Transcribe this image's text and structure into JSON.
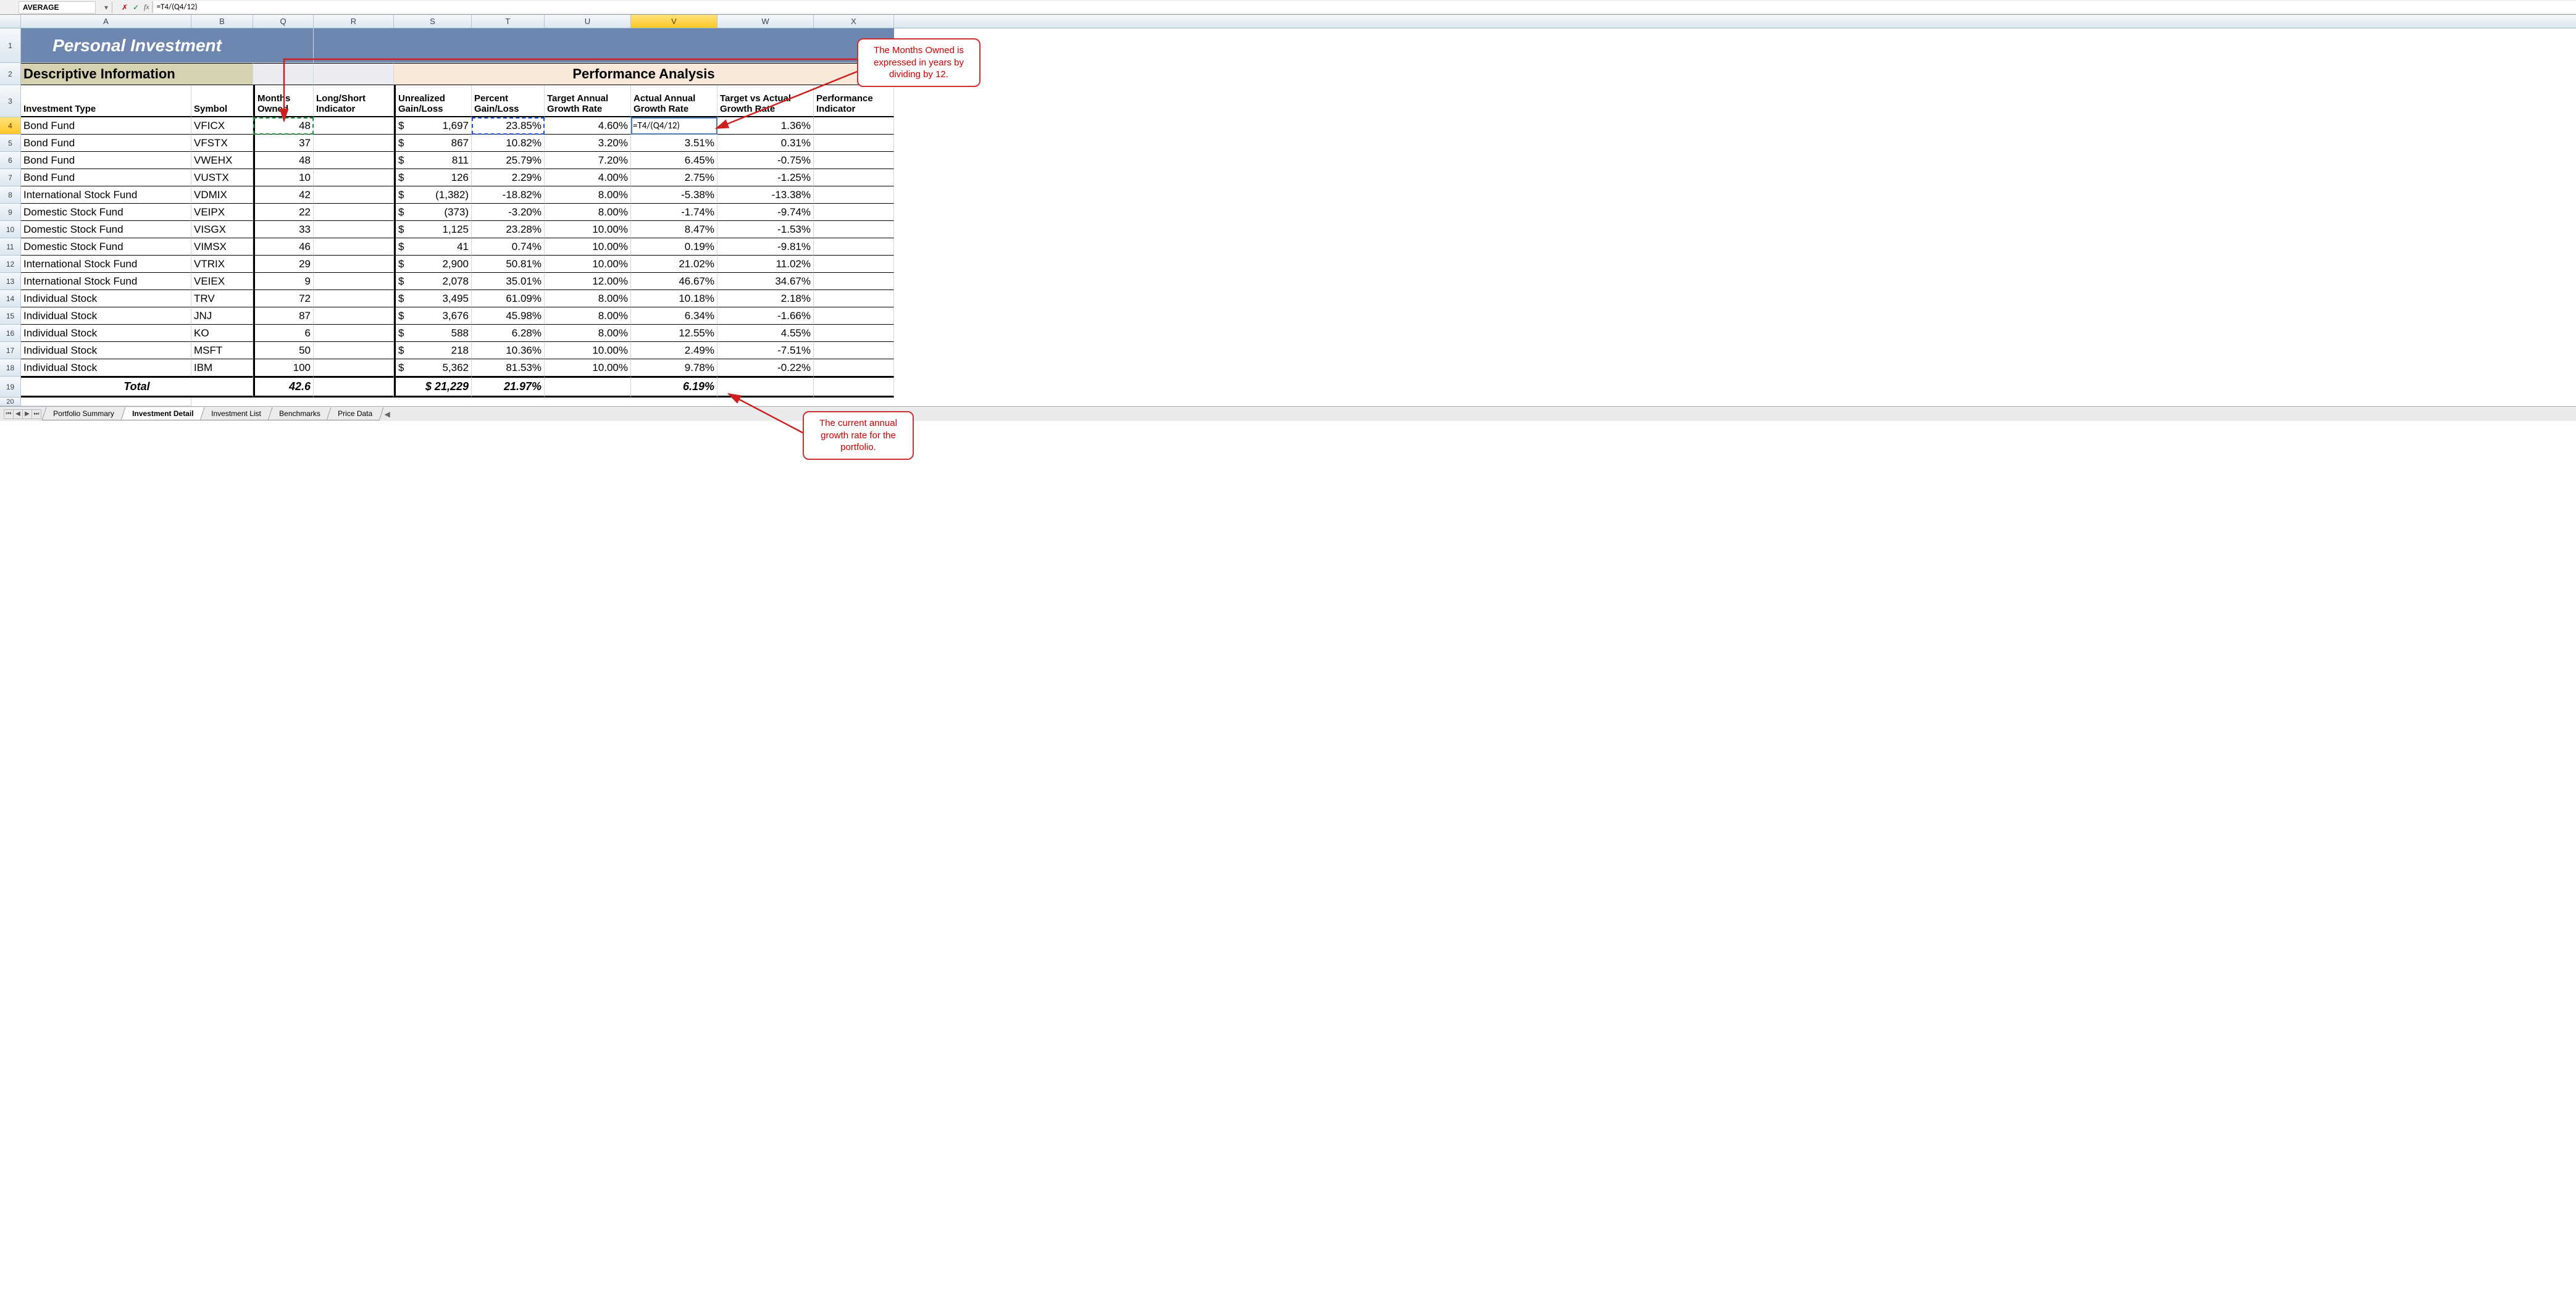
{
  "formula_bar": {
    "name_box": "AVERAGE",
    "dropdown_glyph": "▾",
    "cancel_glyph": "✗",
    "enter_glyph": "✓",
    "fx_label": "fx",
    "formula": "=T4/(Q4/12)"
  },
  "columns": [
    "A",
    "B",
    "Q",
    "R",
    "S",
    "T",
    "U",
    "V",
    "W",
    "X"
  ],
  "active_column": "V",
  "row_numbers": [
    1,
    2,
    3,
    4,
    5,
    6,
    7,
    8,
    9,
    10,
    11,
    12,
    13,
    14,
    15,
    16,
    17,
    18,
    19,
    20
  ],
  "active_row": 4,
  "titles": {
    "main": "Personal Investment",
    "descriptive": "Descriptive Information",
    "performance": "Performance Analysis"
  },
  "headers": {
    "investment_type": "Investment Type",
    "symbol": "Symbol",
    "months_owned": "Months Owned",
    "long_short": "Long/Short Indicator",
    "unrealized": "Unrealized Gain/Loss",
    "percent_gl": "Percent Gain/Loss",
    "target_annual": "Target Annual Growth Rate",
    "actual_annual": "Actual Annual Growth Rate",
    "target_vs_actual": "Target vs Actual Growth Rate",
    "perf_indicator": "Performance Indicator"
  },
  "rows": [
    {
      "type": "Bond Fund",
      "sym": "VFICX",
      "mo": "48",
      "ls": "",
      "ur": "1,697",
      "pct": "23.85%",
      "tgt": "4.60%",
      "act": "=T4/(Q4/12)",
      "tv": "1.36%",
      "pi": ""
    },
    {
      "type": "Bond Fund",
      "sym": "VFSTX",
      "mo": "37",
      "ls": "",
      "ur": "867",
      "pct": "10.82%",
      "tgt": "3.20%",
      "act": "3.51%",
      "tv": "0.31%",
      "pi": ""
    },
    {
      "type": "Bond Fund",
      "sym": "VWEHX",
      "mo": "48",
      "ls": "",
      "ur": "811",
      "pct": "25.79%",
      "tgt": "7.20%",
      "act": "6.45%",
      "tv": "-0.75%",
      "pi": ""
    },
    {
      "type": "Bond Fund",
      "sym": "VUSTX",
      "mo": "10",
      "ls": "",
      "ur": "126",
      "pct": "2.29%",
      "tgt": "4.00%",
      "act": "2.75%",
      "tv": "-1.25%",
      "pi": ""
    },
    {
      "type": "International Stock Fund",
      "sym": "VDMIX",
      "mo": "42",
      "ls": "",
      "ur": "(1,382)",
      "pct": "-18.82%",
      "tgt": "8.00%",
      "act": "-5.38%",
      "tv": "-13.38%",
      "pi": ""
    },
    {
      "type": "Domestic Stock Fund",
      "sym": "VEIPX",
      "mo": "22",
      "ls": "",
      "ur": "(373)",
      "pct": "-3.20%",
      "tgt": "8.00%",
      "act": "-1.74%",
      "tv": "-9.74%",
      "pi": ""
    },
    {
      "type": "Domestic Stock Fund",
      "sym": "VISGX",
      "mo": "33",
      "ls": "",
      "ur": "1,125",
      "pct": "23.28%",
      "tgt": "10.00%",
      "act": "8.47%",
      "tv": "-1.53%",
      "pi": ""
    },
    {
      "type": "Domestic Stock Fund",
      "sym": "VIMSX",
      "mo": "46",
      "ls": "",
      "ur": "41",
      "pct": "0.74%",
      "tgt": "10.00%",
      "act": "0.19%",
      "tv": "-9.81%",
      "pi": ""
    },
    {
      "type": "International Stock Fund",
      "sym": "VTRIX",
      "mo": "29",
      "ls": "",
      "ur": "2,900",
      "pct": "50.81%",
      "tgt": "10.00%",
      "act": "21.02%",
      "tv": "11.02%",
      "pi": ""
    },
    {
      "type": "International Stock Fund",
      "sym": "VEIEX",
      "mo": "9",
      "ls": "",
      "ur": "2,078",
      "pct": "35.01%",
      "tgt": "12.00%",
      "act": "46.67%",
      "tv": "34.67%",
      "pi": ""
    },
    {
      "type": "Individual Stock",
      "sym": "TRV",
      "mo": "72",
      "ls": "",
      "ur": "3,495",
      "pct": "61.09%",
      "tgt": "8.00%",
      "act": "10.18%",
      "tv": "2.18%",
      "pi": ""
    },
    {
      "type": "Individual Stock",
      "sym": "JNJ",
      "mo": "87",
      "ls": "",
      "ur": "3,676",
      "pct": "45.98%",
      "tgt": "8.00%",
      "act": "6.34%",
      "tv": "-1.66%",
      "pi": ""
    },
    {
      "type": "Individual Stock",
      "sym": "KO",
      "mo": "6",
      "ls": "",
      "ur": "588",
      "pct": "6.28%",
      "tgt": "8.00%",
      "act": "12.55%",
      "tv": "4.55%",
      "pi": ""
    },
    {
      "type": "Individual Stock",
      "sym": "MSFT",
      "mo": "50",
      "ls": "",
      "ur": "218",
      "pct": "10.36%",
      "tgt": "10.00%",
      "act": "2.49%",
      "tv": "-7.51%",
      "pi": ""
    },
    {
      "type": "Individual Stock",
      "sym": "IBM",
      "mo": "100",
      "ls": "",
      "ur": "5,362",
      "pct": "81.53%",
      "tgt": "10.00%",
      "act": "9.78%",
      "tv": "-0.22%",
      "pi": ""
    }
  ],
  "totals": {
    "label": "Total",
    "months": "42.6",
    "unrealized": "$ 21,229",
    "percent": "21.97%",
    "actual": "6.19%"
  },
  "sheet_tabs": {
    "nav_first": "⏮",
    "nav_prev": "◀",
    "nav_next": "▶",
    "nav_last": "⏭",
    "tabs": [
      "Portfolio Summary",
      "Investment Detail",
      "Investment List",
      "Benchmarks",
      "Price Data"
    ],
    "active": "Investment Detail",
    "scroll_glyph": "◀"
  },
  "callouts": {
    "top": "The Months Owned is expressed in years by dividing by 12.",
    "bottom": "The current annual growth rate for the portfolio."
  }
}
